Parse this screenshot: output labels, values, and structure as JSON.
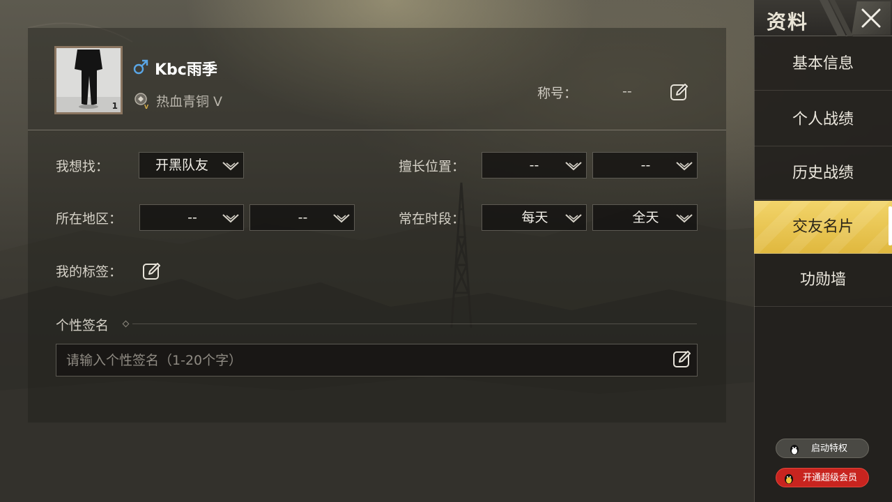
{
  "profile": {
    "name": "Kbc雨季",
    "gender_icon": "male-symbol-icon",
    "rank": "热血青铜 V",
    "avatar_badge": "1",
    "title_label": "称号：",
    "title_value": "--"
  },
  "form": {
    "looking_for": {
      "label": "我想找：",
      "value": "开黑队友"
    },
    "position": {
      "label": "擅长位置：",
      "value1": "--",
      "value2": "--"
    },
    "region": {
      "label": "所在地区：",
      "value1": "--",
      "value2": "--"
    },
    "active_time": {
      "label": "常在时段：",
      "value1": "每天",
      "value2": "全天"
    },
    "tags": {
      "label": "我的标签："
    },
    "signature": {
      "title": "个性签名",
      "placeholder": "请输入个性签名（1-20个字）"
    }
  },
  "sidebar": {
    "title": "资料",
    "items": [
      {
        "label": "基本信息"
      },
      {
        "label": "个人战绩"
      },
      {
        "label": "历史战绩"
      },
      {
        "label": "交友名片"
      },
      {
        "label": "功勋墙"
      }
    ],
    "active_index": 3,
    "privilege_button": "启动特权",
    "svip_button": "开通超级会员"
  },
  "colors": {
    "accent": "#e8c24e",
    "svip_red": "#c8241f",
    "male_blue": "#5aa6e6"
  }
}
